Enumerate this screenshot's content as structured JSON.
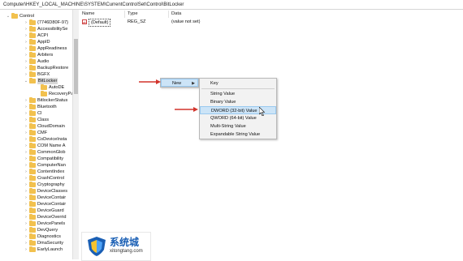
{
  "address": "Computer\\HKEY_LOCAL_MACHINE\\SYSTEM\\CurrentControlSet\\Control\\BitLocker",
  "tree": [
    {
      "label": "Control",
      "level": 0,
      "exp": "down"
    },
    {
      "label": "{7746D80F-97}",
      "level": 1,
      "exp": "right"
    },
    {
      "label": "AccessibilitySe",
      "level": 1,
      "exp": "right"
    },
    {
      "label": "ACPI",
      "level": 1,
      "exp": "right"
    },
    {
      "label": "AppID",
      "level": 1,
      "exp": "right"
    },
    {
      "label": "AppReadiness",
      "level": 1,
      "exp": "right"
    },
    {
      "label": "Arbiters",
      "level": 1,
      "exp": "right"
    },
    {
      "label": "Audio",
      "level": 1,
      "exp": "right"
    },
    {
      "label": "BackupRestore",
      "level": 1,
      "exp": "right"
    },
    {
      "label": "BGFX",
      "level": 1,
      "exp": "right"
    },
    {
      "label": "BitLocker",
      "level": 1,
      "exp": "down",
      "selected": true
    },
    {
      "label": "AutoDE",
      "level": 2,
      "exp": ""
    },
    {
      "label": "RecoveryPa",
      "level": 2,
      "exp": ""
    },
    {
      "label": "BitlockerStatus",
      "level": 1,
      "exp": "right"
    },
    {
      "label": "Bluetooth",
      "level": 1,
      "exp": "right"
    },
    {
      "label": "CI",
      "level": 1,
      "exp": "right"
    },
    {
      "label": "Class",
      "level": 1,
      "exp": "right"
    },
    {
      "label": "CloudDomain",
      "level": 1,
      "exp": "right"
    },
    {
      "label": "CMF",
      "level": 1,
      "exp": "right"
    },
    {
      "label": "CoDeviceInsta",
      "level": 1,
      "exp": "right"
    },
    {
      "label": "COM Name A",
      "level": 1,
      "exp": "right"
    },
    {
      "label": "CommonGlob",
      "level": 1,
      "exp": "right"
    },
    {
      "label": "Compatibility",
      "level": 1,
      "exp": "right"
    },
    {
      "label": "ComputerNan",
      "level": 1,
      "exp": "right"
    },
    {
      "label": "ContentIndex",
      "level": 1,
      "exp": "right"
    },
    {
      "label": "CrashControl",
      "level": 1,
      "exp": "right"
    },
    {
      "label": "Cryptography",
      "level": 1,
      "exp": "right"
    },
    {
      "label": "DeviceClasses",
      "level": 1,
      "exp": "right"
    },
    {
      "label": "DeviceContair",
      "level": 1,
      "exp": "right"
    },
    {
      "label": "DeviceContair",
      "level": 1,
      "exp": "right"
    },
    {
      "label": "DeviceGuard",
      "level": 1,
      "exp": "right"
    },
    {
      "label": "DeviceOverrid",
      "level": 1,
      "exp": "right"
    },
    {
      "label": "DevicePanels",
      "level": 1,
      "exp": "right"
    },
    {
      "label": "DevQuery",
      "level": 1,
      "exp": "right"
    },
    {
      "label": "Diagnostics",
      "level": 1,
      "exp": "right"
    },
    {
      "label": "DmaSecurity",
      "level": 1,
      "exp": "right"
    },
    {
      "label": "EarlyLaunch",
      "level": 1,
      "exp": "right"
    }
  ],
  "columns": {
    "name": "Name",
    "type": "Type",
    "data": "Data"
  },
  "values": [
    {
      "icon": "ab",
      "name": "(Default)",
      "type": "REG_SZ",
      "data": "(value not set)"
    }
  ],
  "context_menu": {
    "new": "New"
  },
  "submenu": [
    "Key",
    "String Value",
    "Binary Value",
    "DWORD (32-bit) Value",
    "QWORD (64-bit) Value",
    "Multi-String Value",
    "Expandable String Value"
  ],
  "watermark": {
    "cn": "系统城",
    "en": "xitongtang.com"
  },
  "colors": {
    "folder": "#f2c14e",
    "highlight": "#cce4f7",
    "arrow": "#d2342c"
  }
}
